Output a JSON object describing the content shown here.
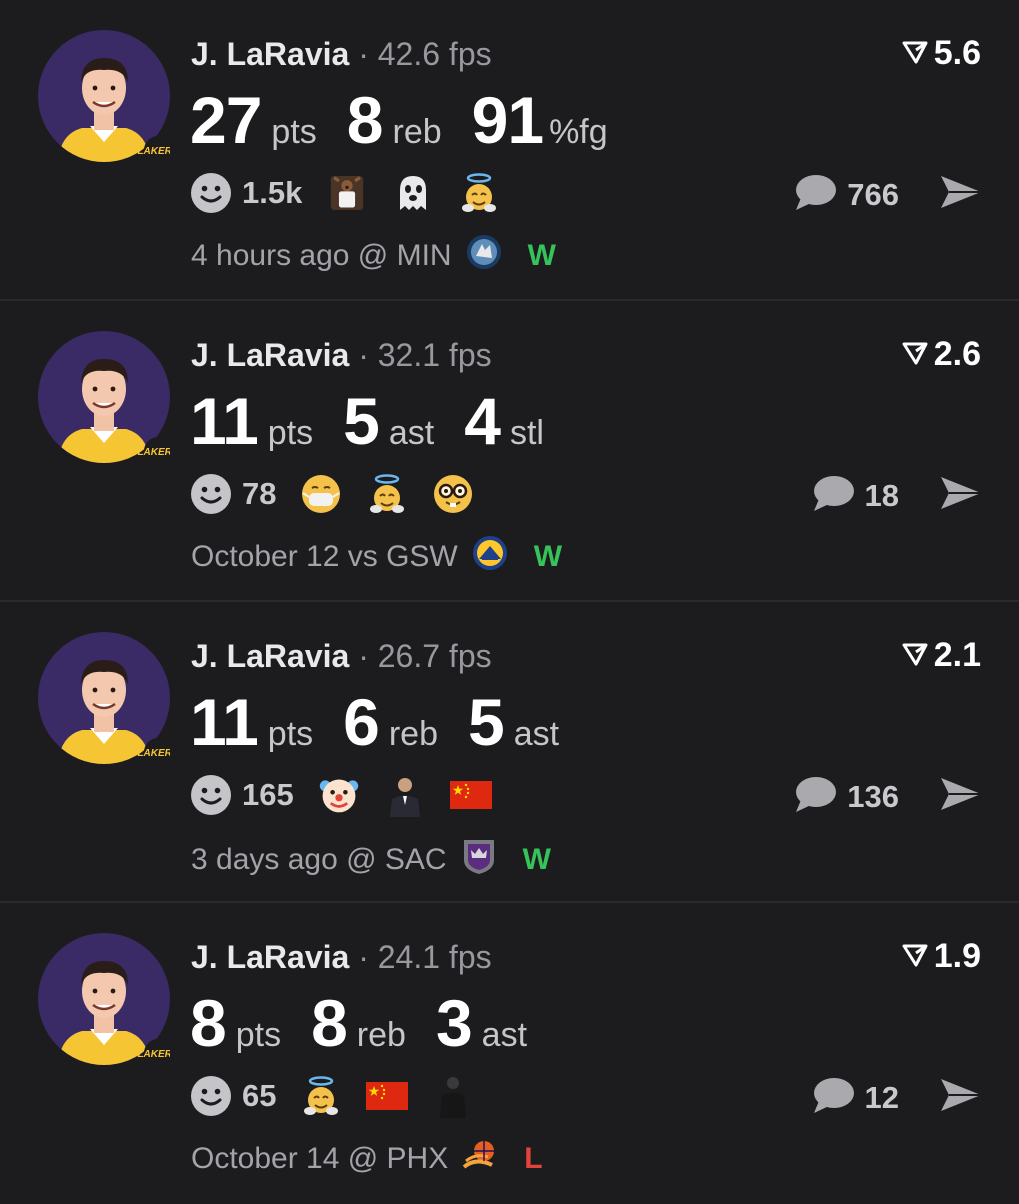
{
  "colors": {
    "background": "#1c1c1e",
    "win": "#35c35a",
    "loss": "#e0443a",
    "muted": "#98989f",
    "avatar_bg": "#3a2a66"
  },
  "posts": [
    {
      "name": "J. LaRavia",
      "separator": "·",
      "fps": "42.6 fps",
      "score": "5.6",
      "stats": [
        {
          "value": "27",
          "unit": "pts"
        },
        {
          "value": "8",
          "unit": "reb"
        },
        {
          "value": "91",
          "unit": "%fg"
        }
      ],
      "reaction_count": "1.5k",
      "reactions": [
        "shocked-man-icon",
        "ghost-icon",
        "angel-face-icon"
      ],
      "comment_count": "766",
      "game_text": "4 hours ago @ MIN",
      "team_logo": "timberwolves-logo",
      "result": "W"
    },
    {
      "name": "J. LaRavia",
      "separator": "·",
      "fps": "32.1 fps",
      "score": "2.6",
      "stats": [
        {
          "value": "11",
          "unit": "pts"
        },
        {
          "value": "5",
          "unit": "ast"
        },
        {
          "value": "4",
          "unit": "stl"
        }
      ],
      "reaction_count": "78",
      "reactions": [
        "mask-face-icon",
        "angel-face-icon",
        "nerd-face-icon"
      ],
      "comment_count": "18",
      "game_text": "October 12 vs GSW",
      "team_logo": "warriors-logo",
      "result": "W"
    },
    {
      "name": "J. LaRavia",
      "separator": "·",
      "fps": "26.7 fps",
      "score": "2.1",
      "stats": [
        {
          "value": "11",
          "unit": "pts"
        },
        {
          "value": "6",
          "unit": "reb"
        },
        {
          "value": "5",
          "unit": "ast"
        }
      ],
      "reaction_count": "165",
      "reactions": [
        "clown-face-icon",
        "suit-man-icon",
        "china-flag-icon"
      ],
      "comment_count": "136",
      "game_text": "3 days ago @ SAC",
      "team_logo": "kings-logo",
      "result": "W"
    },
    {
      "name": "J. LaRavia",
      "separator": "·",
      "fps": "24.1 fps",
      "score": "1.9",
      "stats": [
        {
          "value": "8",
          "unit": "pts"
        },
        {
          "value": "8",
          "unit": "reb"
        },
        {
          "value": "3",
          "unit": "ast"
        }
      ],
      "reaction_count": "65",
      "reactions": [
        "angel-face-icon",
        "china-flag-icon",
        "dark-figure-icon"
      ],
      "comment_count": "12",
      "game_text": "October 14 @ PHX",
      "team_logo": "suns-logo",
      "result": "L"
    }
  ]
}
